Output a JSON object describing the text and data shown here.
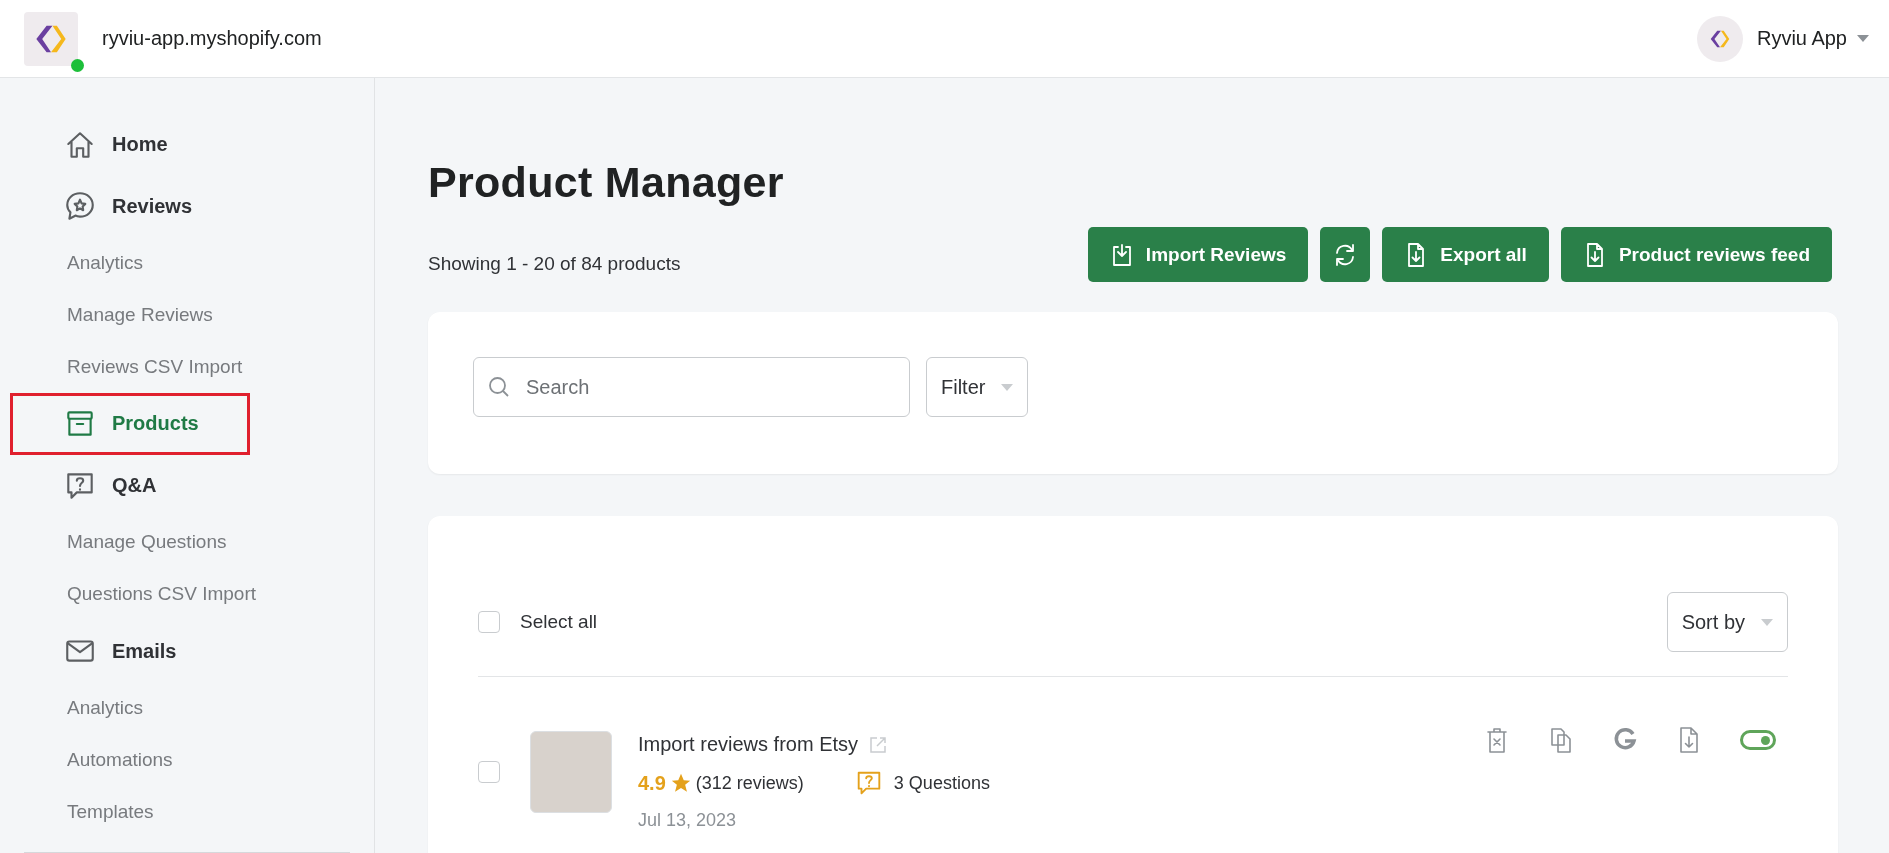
{
  "topbar": {
    "store_name": "ryviu-app.myshopify.com",
    "online": true,
    "account_name": "Ryviu App"
  },
  "sidebar": {
    "items": [
      {
        "label": "Home",
        "selected": false,
        "outlined": false
      },
      {
        "label": "Reviews",
        "selected": false,
        "outlined": false,
        "children": [
          {
            "label": "Analytics",
            "selected": false,
            "outlined": false
          },
          {
            "label": "Manage Reviews",
            "selected": false,
            "outlined": false
          },
          {
            "label": "Reviews CSV Import",
            "selected": false,
            "outlined": false
          }
        ]
      },
      {
        "label": "Products",
        "selected": true,
        "outlined": true
      },
      {
        "label": "Q&A",
        "selected": false,
        "outlined": false,
        "children": [
          {
            "label": "Manage Questions",
            "selected": false,
            "outlined": false
          },
          {
            "label": "Questions CSV Import",
            "selected": false,
            "outlined": false
          }
        ]
      },
      {
        "label": "Emails",
        "selected": false,
        "outlined": false,
        "children": [
          {
            "label": "Analytics",
            "selected": false,
            "outlined": false
          },
          {
            "label": "Automations",
            "selected": false,
            "outlined": false
          },
          {
            "label": "Templates",
            "selected": false,
            "outlined": false
          }
        ]
      }
    ]
  },
  "page": {
    "title": "Product Manager",
    "summary": "Showing 1 - 20 of 84 products",
    "buttons": [
      {
        "label": "Import Reviews",
        "kind": "import"
      },
      {
        "kind": "refresh"
      },
      {
        "label": "Export all",
        "kind": "export"
      },
      {
        "label": "Product reviews feed",
        "kind": "export"
      }
    ]
  },
  "filters": {
    "search": {
      "placeholder": "Search"
    },
    "filter": "Filter"
  },
  "list": {
    "select_all": {
      "label": "Select all",
      "checked": false
    },
    "sort": "Sort by",
    "products": [
      {
        "title": "Import reviews from Etsy",
        "rating": "4.9",
        "reviews": "(312 reviews)",
        "questions": "3 Questions",
        "date": "Jul 13, 2023",
        "checked": false,
        "enabled": true
      }
    ]
  }
}
